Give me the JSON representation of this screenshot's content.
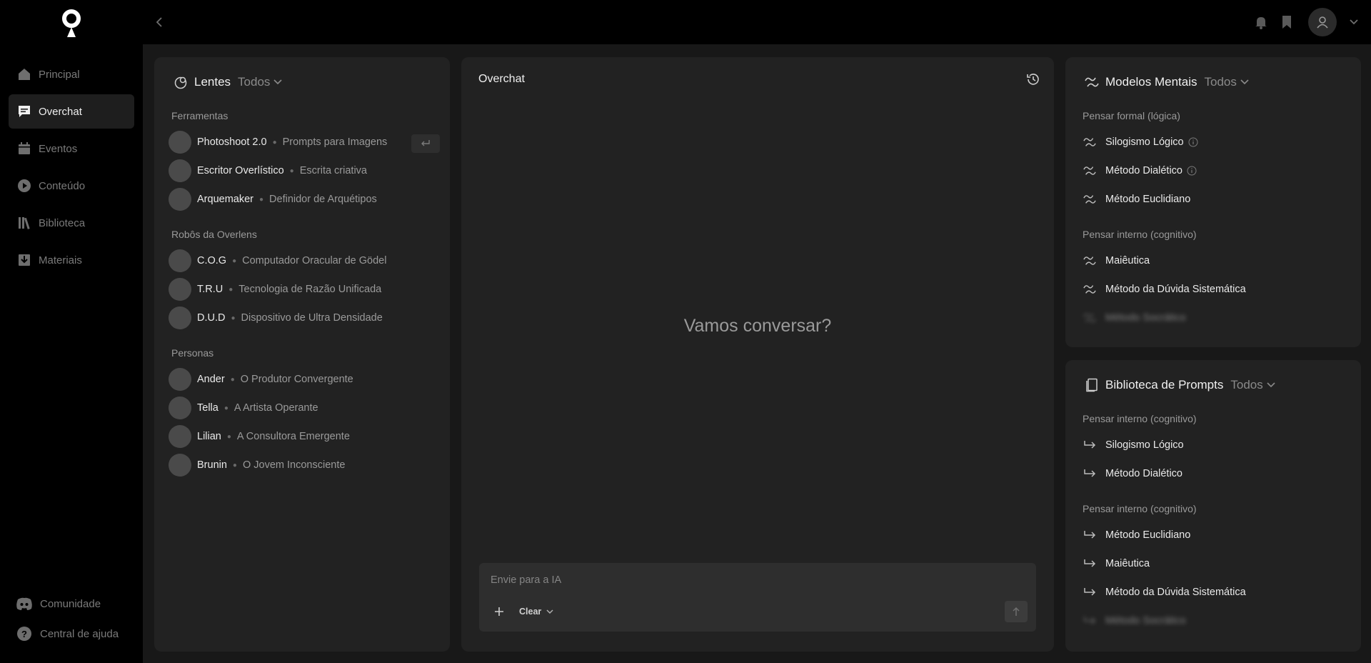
{
  "sidebar": {
    "items": [
      {
        "label": "Principal",
        "icon": "home-icon",
        "active": false
      },
      {
        "label": "Overchat",
        "icon": "chat-icon",
        "active": true
      },
      {
        "label": "Eventos",
        "icon": "calendar-icon",
        "active": false
      },
      {
        "label": "Conteúdo",
        "icon": "play-icon",
        "active": false
      },
      {
        "label": "Biblioteca",
        "icon": "library-icon",
        "active": false
      },
      {
        "label": "Materiais",
        "icon": "download-icon",
        "active": false
      }
    ],
    "footer": [
      {
        "label": "Comunidade",
        "icon": "discord-icon"
      },
      {
        "label": "Central de ajuda",
        "icon": "help-icon"
      }
    ]
  },
  "lentes": {
    "title": "Lentes",
    "filter": "Todos",
    "sections": [
      {
        "title": "Ferramentas",
        "items": [
          {
            "name": "Photoshoot 2.0",
            "desc": "Prompts para Imagens"
          },
          {
            "name": "Escritor Overlístico",
            "desc": "Escrita criativa"
          },
          {
            "name": "Arquemaker",
            "desc": "Definidor de Arquétipos"
          }
        ]
      },
      {
        "title": "Robôs da Overlens",
        "items": [
          {
            "name": "C.O.G",
            "desc": "Computador Oracular de Gödel"
          },
          {
            "name": "T.R.U",
            "desc": "Tecnologia de Razão Unificada"
          },
          {
            "name": "D.U.D",
            "desc": "Dispositivo de Ultra Densidade"
          }
        ]
      },
      {
        "title": "Personas",
        "items": [
          {
            "name": "Ander",
            "desc": "O Produtor Convergente"
          },
          {
            "name": "Tella",
            "desc": "A Artista Operante"
          },
          {
            "name": "Lilian",
            "desc": "A Consultora Emergente"
          },
          {
            "name": "Brunin",
            "desc": "O Jovem Inconsciente"
          }
        ]
      }
    ]
  },
  "chat": {
    "title": "Overchat",
    "empty_message": "Vamos conversar?",
    "input_placeholder": "Envie para a IA",
    "model_select": "Clear"
  },
  "modelos": {
    "title": "Modelos Mentais",
    "filter": "Todos",
    "sections": [
      {
        "title": "Pensar formal (lógica)",
        "items": [
          {
            "label": "Silogismo Lógico",
            "info": true
          },
          {
            "label": "Método Dialético",
            "info": true
          },
          {
            "label": "Método Euclidiano",
            "info": false
          }
        ]
      },
      {
        "title": "Pensar interno (cognitivo)",
        "items": [
          {
            "label": "Maiêutica",
            "info": false
          },
          {
            "label": "Método da Dúvida Sistemática",
            "info": false
          },
          {
            "label": "Método Socrático",
            "info": false,
            "faded": true
          }
        ]
      }
    ]
  },
  "prompts": {
    "title": "Biblioteca de Prompts",
    "filter": "Todos",
    "sections": [
      {
        "title": "Pensar interno (cognitivo)",
        "items": [
          {
            "label": "Silogismo Lógico"
          },
          {
            "label": "Método Dialético"
          }
        ]
      },
      {
        "title": "Pensar interno (cognitivo)",
        "items": [
          {
            "label": "Método Euclidiano"
          },
          {
            "label": "Maiêutica"
          },
          {
            "label": "Método da Dúvida Sistemática"
          },
          {
            "label": "Método Socrático",
            "faded": true
          }
        ]
      }
    ]
  },
  "colors": {
    "background": "#000000",
    "main": "#181818",
    "panel": "#222222",
    "text": "#eaeaea",
    "muted": "#9a9a9a"
  }
}
